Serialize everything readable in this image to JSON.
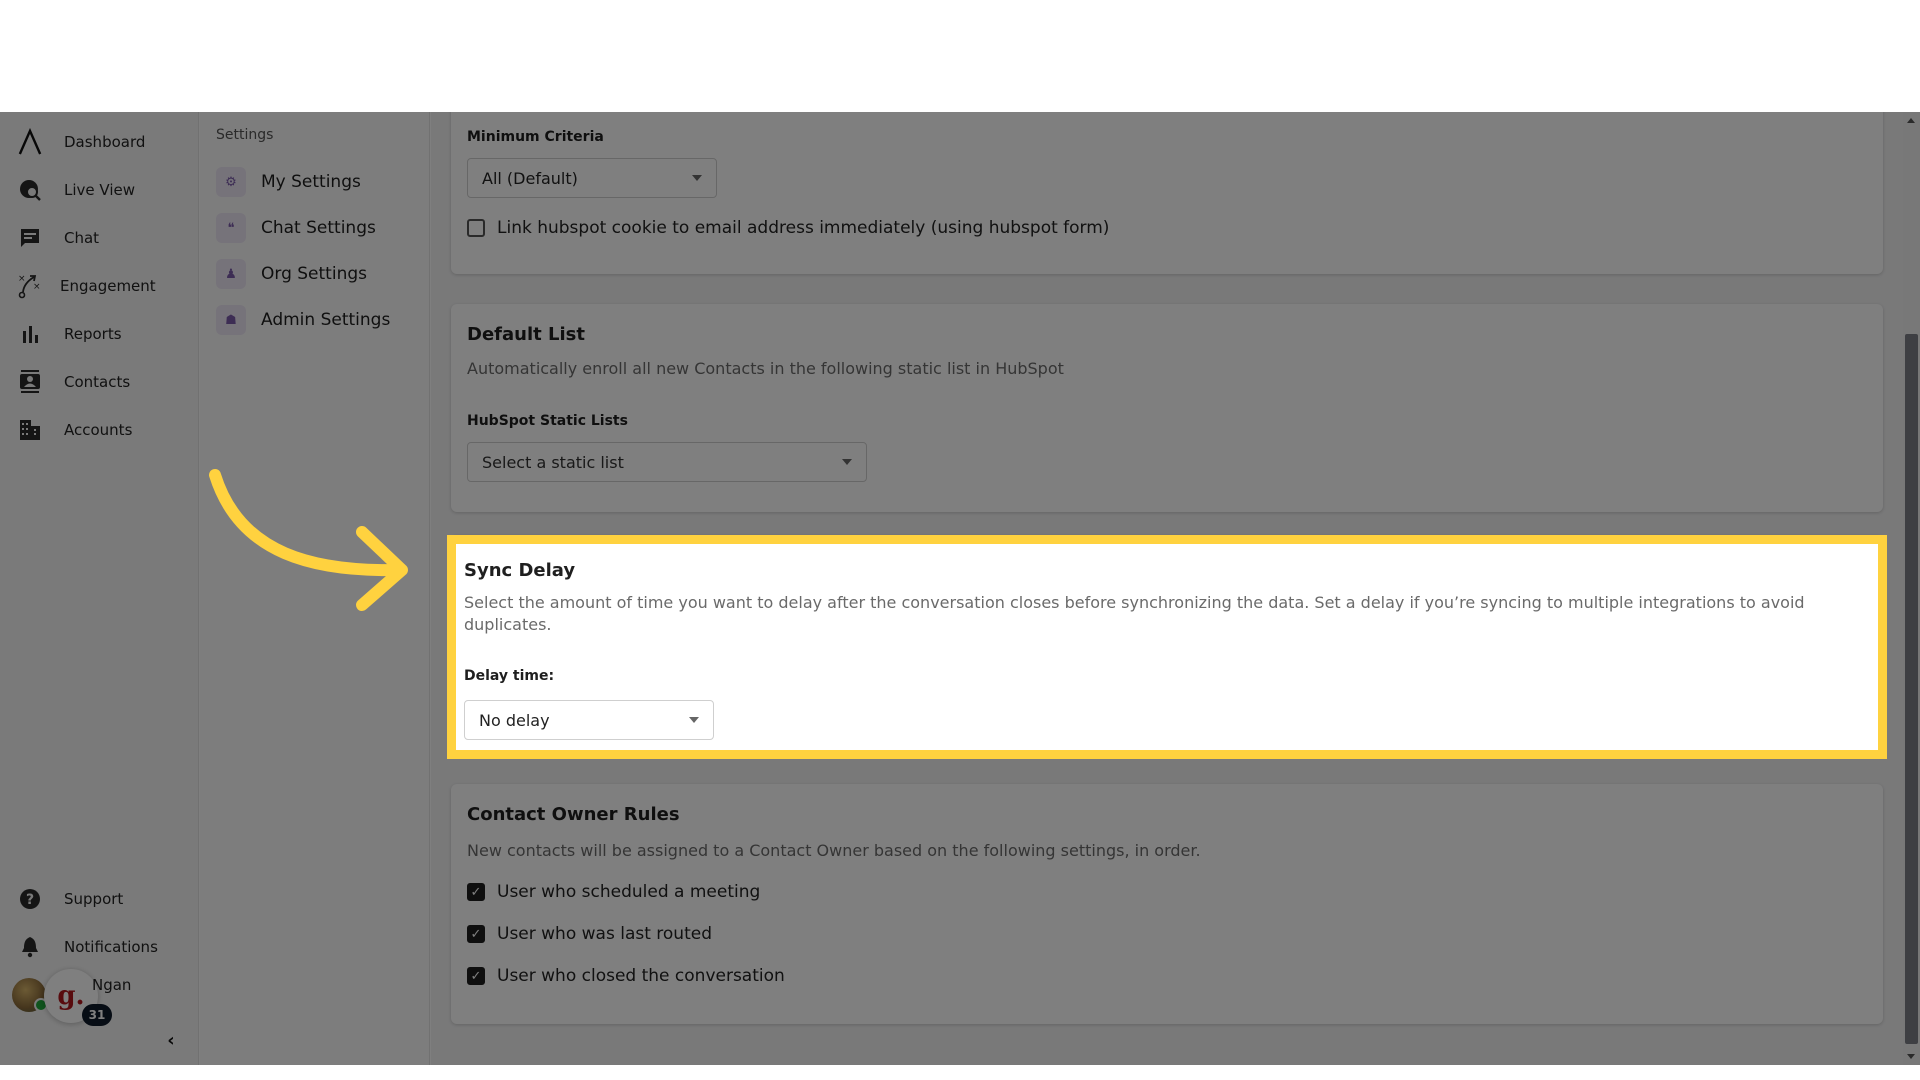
{
  "nav": {
    "items": [
      {
        "icon": "logo-caret-icon",
        "label": "Dashboard"
      },
      {
        "icon": "live-view-icon",
        "label": "Live View"
      },
      {
        "icon": "chat-icon",
        "label": "Chat"
      },
      {
        "icon": "engagement-icon",
        "label": "Engagement"
      },
      {
        "icon": "reports-icon",
        "label": "Reports"
      },
      {
        "icon": "contacts-icon",
        "label": "Contacts"
      },
      {
        "icon": "accounts-icon",
        "label": "Accounts"
      }
    ],
    "bottom_items": [
      {
        "icon": "help-icon",
        "label": "Support"
      },
      {
        "icon": "bell-icon",
        "label": "Notifications"
      }
    ],
    "user": {
      "name": "Ngan",
      "badge_letter": "g.",
      "count": "31"
    },
    "collapse_glyph": "‹"
  },
  "subnav": {
    "title": "Settings",
    "items": [
      {
        "icon": "gear-icon",
        "glyph": "⚙",
        "label": "My Settings"
      },
      {
        "icon": "chat-bubbles-icon",
        "glyph": "❝",
        "label": "Chat Settings"
      },
      {
        "icon": "org-icon",
        "glyph": "♟",
        "label": "Org Settings"
      },
      {
        "icon": "admin-icon",
        "glyph": "☗",
        "label": "Admin Settings"
      }
    ]
  },
  "main": {
    "minimum_criteria": {
      "label": "Minimum Criteria",
      "value": "All (Default)",
      "checkbox_label": "Link hubspot cookie to email address immediately (using hubspot form)",
      "checkbox_checked": false
    },
    "default_list": {
      "title": "Default List",
      "description": "Automatically enroll all new Contacts in the following static list in HubSpot",
      "field_label": "HubSpot Static Lists",
      "placeholder": "Select a static list"
    },
    "sync_delay": {
      "title": "Sync Delay",
      "description": "Select the amount of time you want to delay after the conversation closes before synchronizing the data. Set a delay if you’re syncing to multiple integrations to avoid duplicates.",
      "field_label": "Delay time:",
      "value": "No delay"
    },
    "contact_owner_rules": {
      "title": "Contact Owner Rules",
      "description": "New contacts will be assigned to a Contact Owner based on the following settings, in order.",
      "rules": [
        {
          "label": "User who scheduled a meeting",
          "checked": true
        },
        {
          "label": "User who was last routed",
          "checked": true
        },
        {
          "label": "User who closed the conversation",
          "checked": true
        }
      ]
    }
  },
  "annotation": {
    "highlight_color": "#ffd23f",
    "overlay_color": "#000000"
  }
}
